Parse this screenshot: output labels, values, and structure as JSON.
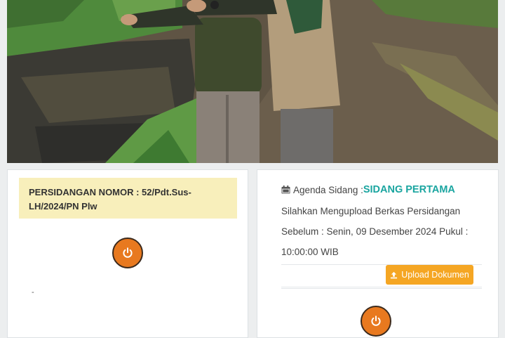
{
  "photo": {
    "icon": "field-photo",
    "colors": {
      "water": "#3a3a36",
      "grass": "#5f9a45",
      "soil": "#5f5444"
    }
  },
  "case_card": {
    "title": "PERSIDANGAN NOMOR : 52/Pdt.Sus-LH/2024/PN Plw",
    "extra_text": "-",
    "power_icon": "power-icon",
    "banner_color": "#f8efbb"
  },
  "agenda_card": {
    "calendar_icon": "calendar-icon",
    "agenda_label": "Agenda Sidang : ",
    "agenda_value": "SIDANG PERTAMA",
    "notice": "Silahkan Mengupload Berkas Persidangan Sebelum : Senin, 09 Desember 2024 Pukul : 10:00:00 WIB",
    "upload_button": "Upload Dokumen",
    "upload_icon": "upload-icon",
    "power_icon": "power-icon",
    "accent_color": "#1aa5a0",
    "button_color": "#f5a623"
  }
}
